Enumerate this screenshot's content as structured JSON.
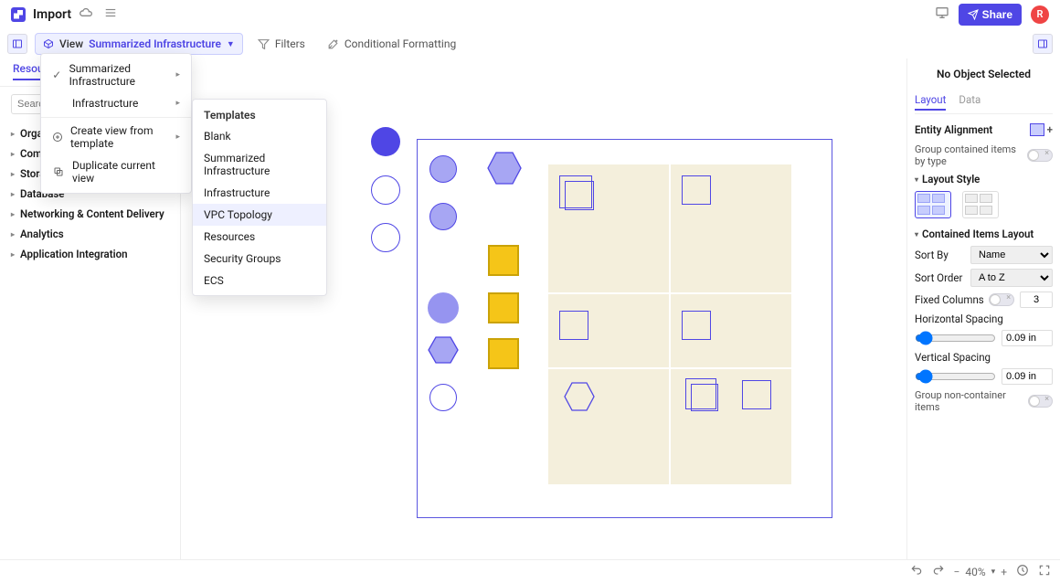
{
  "header": {
    "title": "Import",
    "share": "Share",
    "avatar": "R"
  },
  "toolbar": {
    "view_label": "View",
    "view_value": "Summarized Infrastructure",
    "filters": "Filters",
    "conditional": "Conditional Formatting"
  },
  "view_menu": {
    "items": [
      {
        "icon": "check",
        "label": "Summarized Infrastructure",
        "sub": true
      },
      {
        "icon": "",
        "label": "Infrastructure",
        "sub": true
      },
      {
        "icon": "plus-circle",
        "label": "Create view from template",
        "sub": true
      },
      {
        "icon": "copy",
        "label": "Duplicate current view",
        "sub": false
      }
    ],
    "templates_header": "Templates",
    "templates": [
      "Blank",
      "Summarized Infrastructure",
      "Infrastructure",
      "VPC Topology",
      "Resources",
      "Security Groups",
      "ECS"
    ],
    "templates_hover_index": 3
  },
  "left_panel": {
    "tabs": [
      "Resources"
    ],
    "search_placeholder": "Search",
    "tree": [
      "Organization",
      "Compute",
      "Storage",
      "Database",
      "Networking & Content Delivery",
      "Analytics",
      "Application Integration"
    ]
  },
  "right_panel": {
    "title": "No Object Selected",
    "tabs": [
      "Layout",
      "Data"
    ],
    "active_tab": 0,
    "entity_alignment": "Entity Alignment",
    "group_hint": "Group contained items by type",
    "layout_style": "Layout Style",
    "contained_layout": "Contained Items Layout",
    "sort_by_label": "Sort By",
    "sort_by_value": "Name",
    "sort_order_label": "Sort Order",
    "sort_order_value": "A to Z",
    "fixed_columns_label": "Fixed Columns",
    "fixed_columns_value": "3",
    "hspacing_label": "Horizontal Spacing",
    "hspacing_value": "0.09 in",
    "vspacing_label": "Vertical Spacing",
    "vspacing_value": "0.09 in",
    "group_nc": "Group non-container items"
  },
  "footer": {
    "zoom": "40%"
  }
}
